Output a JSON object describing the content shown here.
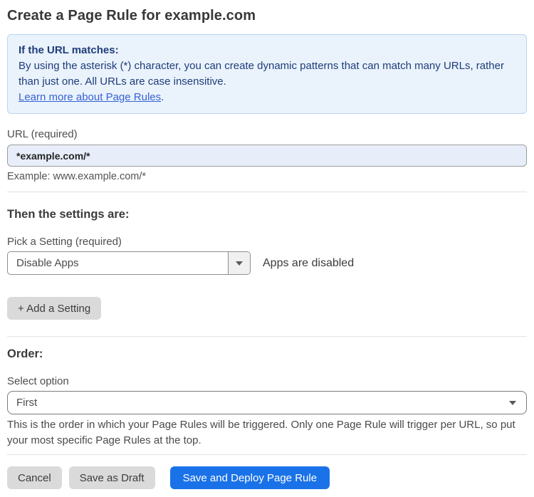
{
  "page": {
    "title": "Create a Page Rule for example.com"
  },
  "info_box": {
    "heading": "If the URL matches:",
    "body": "By using the asterisk (*) character, you can create dynamic patterns that can match many URLs, rather than just one. All URLs are case insensitive.",
    "link_label": "Learn more about Page Rules",
    "link_suffix": "."
  },
  "url_field": {
    "label": "URL (required)",
    "value": "*example.com/*",
    "helper": "Example: www.example.com/*"
  },
  "settings": {
    "heading": "Then the settings are:",
    "picker_label": "Pick a Setting (required)",
    "selected_setting": "Disable Apps",
    "status_text": "Apps are disabled",
    "add_button_label": "+ Add a Setting"
  },
  "order": {
    "heading": "Order:",
    "select_label": "Select option",
    "selected_option": "First",
    "helper": "This is the order in which your Page Rules will be triggered. Only one Page Rule will trigger per URL, so put your most specific Page Rules at the top."
  },
  "footer": {
    "cancel_label": "Cancel",
    "save_draft_label": "Save as Draft",
    "save_deploy_label": "Save and Deploy Page Rule"
  },
  "colors": {
    "accent_blue": "#1a72e8",
    "info_background": "#eaf2fc",
    "info_border": "#b9d5f1",
    "info_text": "#1f3d7a",
    "link_blue": "#3562d4",
    "input_background": "#e7eefa",
    "gray_button": "#dadada"
  },
  "icons": {
    "dropdown_arrow": "caret-down"
  }
}
